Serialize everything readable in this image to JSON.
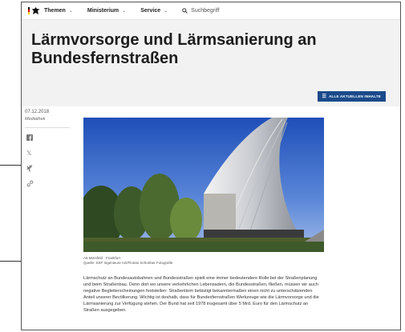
{
  "nav": {
    "items": [
      {
        "label": "Themen"
      },
      {
        "label": "Ministerium"
      },
      {
        "label": "Service"
      }
    ],
    "search_placeholder": "Suchbegriff"
  },
  "page": {
    "title": "Lärmvorsorge und Lärmsanierung an Bundesfernstraßen",
    "all_button": "ALLE AKTUELLEN INHALTE"
  },
  "meta": {
    "date": "07.12.2018",
    "mediathek": "Mediathek"
  },
  "photo": {
    "caption_line1": "A5 Mörsfeld · Frankfurt",
    "caption_line2": "Quelle: SSF Ingenieure AG/Florian Schreiber Fotografie"
  },
  "body": {
    "paragraph": "Lärmschutz an Bundesautobahnen und Bundesstraßen spielt eine immer bedeutendere Rolle bei der Straßenplanung und beim Straßenbau. Denn dort wo unsere verkehrlichen Lebensadern, die Bundesstraßen, fließen, müssen wir auch negative Begleiterscheinungen feststellen: Straßenlärm belästigt bekanntermaßen einen nicht zu unterschätzenden Anteil unserer Bevölkerung. Wichtig ist deshalb, dass für Bundesfernstraßen Werkzeuge wie die Lärmvorsorge und die Lärmsanierung zur Verfügung stehen. Der Bund hat seit 1978 insgesamt über 5 Mrd. Euro für den Lärmschutz an Straßen ausgegeben."
  },
  "colors": {
    "accent": "#1a4a8a",
    "hero_bg": "#f2f2f2"
  }
}
